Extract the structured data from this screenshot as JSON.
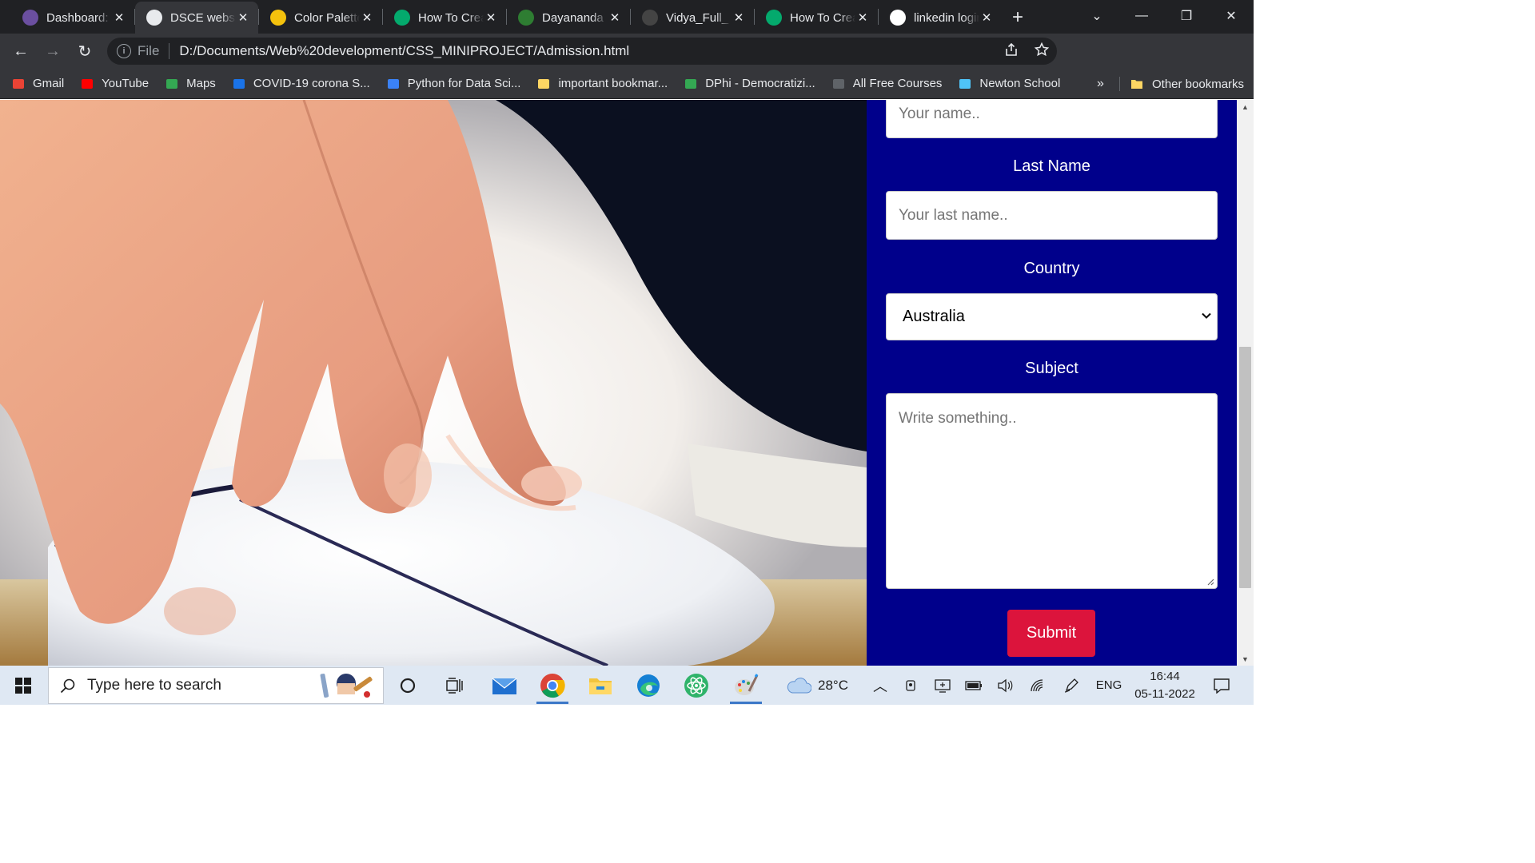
{
  "browser": {
    "tabs": [
      {
        "title": "Dashboard:",
        "icon": "dashboard-favicon",
        "color": "#6b4fa0",
        "active": false
      },
      {
        "title": "DSCE website",
        "icon": "globe-favicon",
        "color": "#e8eaed",
        "active": true
      },
      {
        "title": "Color Palette",
        "icon": "palette-favicon",
        "color": "#f4c20d",
        "active": false
      },
      {
        "title": "How To Create",
        "icon": "w3schools-favicon",
        "color": "#04aa6d",
        "active": false
      },
      {
        "title": "Dayananda",
        "icon": "dsce-favicon",
        "color": "#2e7d32",
        "active": false
      },
      {
        "title": "Vidya_Full_",
        "icon": "github-favicon",
        "color": "#444444",
        "active": false
      },
      {
        "title": "How To Create",
        "icon": "w3schools-favicon",
        "color": "#04aa6d",
        "active": false
      },
      {
        "title": "linkedin login",
        "icon": "google-favicon",
        "color": "#ffffff",
        "active": false
      }
    ],
    "new_tab_symbol": "+",
    "window_controls": {
      "tab_search": "⌄",
      "minimize": "—",
      "restore": "❐",
      "close": "✕"
    },
    "address": {
      "scheme_label": "File",
      "url": "D:/Documents/Web%20development/CSS_MINIPROJECT/Admission.html"
    },
    "nav": {
      "back": "←",
      "forward": "→",
      "reload": "↻"
    },
    "bookmarks": [
      {
        "label": "Gmail",
        "icon": "gmail-icon",
        "color": "#ea4335"
      },
      {
        "label": "YouTube",
        "icon": "youtube-icon",
        "color": "#ff0000"
      },
      {
        "label": "Maps",
        "icon": "maps-icon",
        "color": "#34a853"
      },
      {
        "label": "COVID-19 corona S...",
        "icon": "covid-icon",
        "color": "#1a73e8"
      },
      {
        "label": "Python for Data Sci...",
        "icon": "python-icon",
        "color": "#3b82f6"
      },
      {
        "label": "important bookmar...",
        "icon": "folder-icon",
        "color": "#fdd663"
      },
      {
        "label": "DPhi - Democratizi...",
        "icon": "dphi-icon",
        "color": "#34a853"
      },
      {
        "label": "All Free Courses",
        "icon": "courses-icon",
        "color": "#5f6368"
      },
      {
        "label": "Newton School",
        "icon": "newton-icon",
        "color": "#4fc3f7"
      }
    ],
    "bookmarks_more": "»",
    "other_bookmarks": "Other bookmarks"
  },
  "form": {
    "first_name_placeholder": "Your name..",
    "last_name_label": "Last Name",
    "last_name_placeholder": "Your last name..",
    "country_label": "Country",
    "country_selected": "Australia",
    "subject_label": "Subject",
    "subject_placeholder": "Write something..",
    "submit_label": "Submit",
    "panel_color": "#00008b",
    "submit_color": "#dc143c"
  },
  "taskbar": {
    "search_placeholder": "Type here to search",
    "weather": "28°C",
    "language": "ENG",
    "time": "16:44",
    "date": "05-11-2022"
  }
}
